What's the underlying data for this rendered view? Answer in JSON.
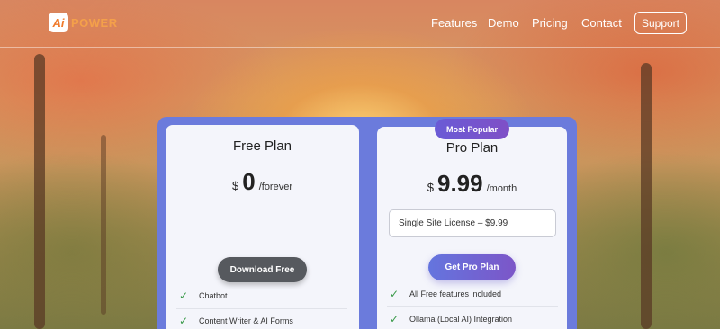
{
  "header": {
    "logo_mark": "Ai",
    "logo_text": "POWER",
    "nav": [
      "Features",
      "Demo",
      "Pricing",
      "Contact"
    ],
    "support_label": "Support"
  },
  "plans": {
    "free": {
      "title": "Free Plan",
      "currency": "$",
      "amount": "0",
      "period": "/forever",
      "button": "Download Free",
      "features": [
        "Chatbot",
        "Content Writer & AI Forms"
      ]
    },
    "pro": {
      "badge": "Most Popular",
      "title": "Pro Plan",
      "currency": "$",
      "amount": "9.99",
      "period": "/month",
      "license_selected": "Single Site License – $9.99",
      "button": "Get Pro Plan",
      "features": [
        "All Free features included",
        "Ollama (Local AI) Integration"
      ]
    }
  },
  "colors": {
    "accent": "#6b7bdc",
    "check": "#3a9a4a",
    "logo": "#f07a2a"
  }
}
